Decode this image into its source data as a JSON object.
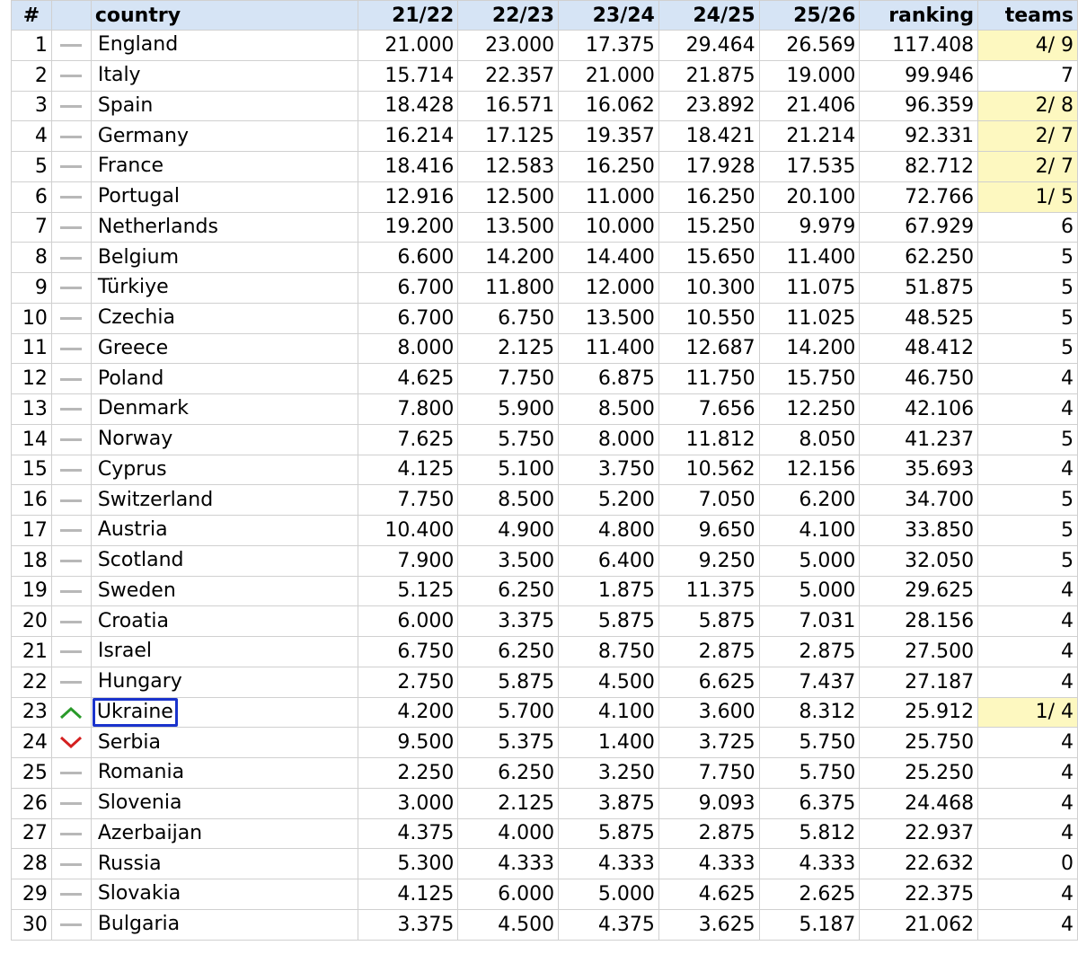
{
  "table": {
    "headers": {
      "rank_no": "#",
      "country": "country",
      "s1": "21/22",
      "s2": "22/23",
      "s3": "23/24",
      "s4": "24/25",
      "s5": "25/26",
      "ranking": "ranking",
      "teams": "teams"
    },
    "selected_country": "Ukraine",
    "colors": {
      "header_bg": "#d6e4f5",
      "teams_highlight": "#fdf8c0",
      "selection_border": "#1a33cc",
      "trend_up": "#2a9a2a",
      "trend_down": "#d42020",
      "trend_same": "#b8b8b8"
    },
    "rows": [
      {
        "no": "1",
        "trend": "same",
        "country": "England",
        "s1": "21.000",
        "s2": "23.000",
        "s3": "17.375",
        "s4": "29.464",
        "s5": "26.569",
        "ranking": "117.408",
        "teams": "4/ 9",
        "teams_highlight": true
      },
      {
        "no": "2",
        "trend": "same",
        "country": "Italy",
        "s1": "15.714",
        "s2": "22.357",
        "s3": "21.000",
        "s4": "21.875",
        "s5": "19.000",
        "ranking": "99.946",
        "teams": "7",
        "teams_highlight": false
      },
      {
        "no": "3",
        "trend": "same",
        "country": "Spain",
        "s1": "18.428",
        "s2": "16.571",
        "s3": "16.062",
        "s4": "23.892",
        "s5": "21.406",
        "ranking": "96.359",
        "teams": "2/ 8",
        "teams_highlight": true
      },
      {
        "no": "4",
        "trend": "same",
        "country": "Germany",
        "s1": "16.214",
        "s2": "17.125",
        "s3": "19.357",
        "s4": "18.421",
        "s5": "21.214",
        "ranking": "92.331",
        "teams": "2/ 7",
        "teams_highlight": true
      },
      {
        "no": "5",
        "trend": "same",
        "country": "France",
        "s1": "18.416",
        "s2": "12.583",
        "s3": "16.250",
        "s4": "17.928",
        "s5": "17.535",
        "ranking": "82.712",
        "teams": "2/ 7",
        "teams_highlight": true
      },
      {
        "no": "6",
        "trend": "same",
        "country": "Portugal",
        "s1": "12.916",
        "s2": "12.500",
        "s3": "11.000",
        "s4": "16.250",
        "s5": "20.100",
        "ranking": "72.766",
        "teams": "1/ 5",
        "teams_highlight": true
      },
      {
        "no": "7",
        "trend": "same",
        "country": "Netherlands",
        "s1": "19.200",
        "s2": "13.500",
        "s3": "10.000",
        "s4": "15.250",
        "s5": "9.979",
        "ranking": "67.929",
        "teams": "6",
        "teams_highlight": false
      },
      {
        "no": "8",
        "trend": "same",
        "country": "Belgium",
        "s1": "6.600",
        "s2": "14.200",
        "s3": "14.400",
        "s4": "15.650",
        "s5": "11.400",
        "ranking": "62.250",
        "teams": "5",
        "teams_highlight": false
      },
      {
        "no": "9",
        "trend": "same",
        "country": "Türkiye",
        "s1": "6.700",
        "s2": "11.800",
        "s3": "12.000",
        "s4": "10.300",
        "s5": "11.075",
        "ranking": "51.875",
        "teams": "5",
        "teams_highlight": false
      },
      {
        "no": "10",
        "trend": "same",
        "country": "Czechia",
        "s1": "6.700",
        "s2": "6.750",
        "s3": "13.500",
        "s4": "10.550",
        "s5": "11.025",
        "ranking": "48.525",
        "teams": "5",
        "teams_highlight": false
      },
      {
        "no": "11",
        "trend": "same",
        "country": "Greece",
        "s1": "8.000",
        "s2": "2.125",
        "s3": "11.400",
        "s4": "12.687",
        "s5": "14.200",
        "ranking": "48.412",
        "teams": "5",
        "teams_highlight": false
      },
      {
        "no": "12",
        "trend": "same",
        "country": "Poland",
        "s1": "4.625",
        "s2": "7.750",
        "s3": "6.875",
        "s4": "11.750",
        "s5": "15.750",
        "ranking": "46.750",
        "teams": "4",
        "teams_highlight": false
      },
      {
        "no": "13",
        "trend": "same",
        "country": "Denmark",
        "s1": "7.800",
        "s2": "5.900",
        "s3": "8.500",
        "s4": "7.656",
        "s5": "12.250",
        "ranking": "42.106",
        "teams": "4",
        "teams_highlight": false
      },
      {
        "no": "14",
        "trend": "same",
        "country": "Norway",
        "s1": "7.625",
        "s2": "5.750",
        "s3": "8.000",
        "s4": "11.812",
        "s5": "8.050",
        "ranking": "41.237",
        "teams": "5",
        "teams_highlight": false
      },
      {
        "no": "15",
        "trend": "same",
        "country": "Cyprus",
        "s1": "4.125",
        "s2": "5.100",
        "s3": "3.750",
        "s4": "10.562",
        "s5": "12.156",
        "ranking": "35.693",
        "teams": "4",
        "teams_highlight": false
      },
      {
        "no": "16",
        "trend": "same",
        "country": "Switzerland",
        "s1": "7.750",
        "s2": "8.500",
        "s3": "5.200",
        "s4": "7.050",
        "s5": "6.200",
        "ranking": "34.700",
        "teams": "5",
        "teams_highlight": false
      },
      {
        "no": "17",
        "trend": "same",
        "country": "Austria",
        "s1": "10.400",
        "s2": "4.900",
        "s3": "4.800",
        "s4": "9.650",
        "s5": "4.100",
        "ranking": "33.850",
        "teams": "5",
        "teams_highlight": false
      },
      {
        "no": "18",
        "trend": "same",
        "country": "Scotland",
        "s1": "7.900",
        "s2": "3.500",
        "s3": "6.400",
        "s4": "9.250",
        "s5": "5.000",
        "ranking": "32.050",
        "teams": "5",
        "teams_highlight": false
      },
      {
        "no": "19",
        "trend": "same",
        "country": "Sweden",
        "s1": "5.125",
        "s2": "6.250",
        "s3": "1.875",
        "s4": "11.375",
        "s5": "5.000",
        "ranking": "29.625",
        "teams": "4",
        "teams_highlight": false
      },
      {
        "no": "20",
        "trend": "same",
        "country": "Croatia",
        "s1": "6.000",
        "s2": "3.375",
        "s3": "5.875",
        "s4": "5.875",
        "s5": "7.031",
        "ranking": "28.156",
        "teams": "4",
        "teams_highlight": false
      },
      {
        "no": "21",
        "trend": "same",
        "country": "Israel",
        "s1": "6.750",
        "s2": "6.250",
        "s3": "8.750",
        "s4": "2.875",
        "s5": "2.875",
        "ranking": "27.500",
        "teams": "4",
        "teams_highlight": false
      },
      {
        "no": "22",
        "trend": "same",
        "country": "Hungary",
        "s1": "2.750",
        "s2": "5.875",
        "s3": "4.500",
        "s4": "6.625",
        "s5": "7.437",
        "ranking": "27.187",
        "teams": "4",
        "teams_highlight": false
      },
      {
        "no": "23",
        "trend": "up",
        "country": "Ukraine",
        "s1": "4.200",
        "s2": "5.700",
        "s3": "4.100",
        "s4": "3.600",
        "s5": "8.312",
        "ranking": "25.912",
        "teams": "1/ 4",
        "teams_highlight": true
      },
      {
        "no": "24",
        "trend": "down",
        "country": "Serbia",
        "s1": "9.500",
        "s2": "5.375",
        "s3": "1.400",
        "s4": "3.725",
        "s5": "5.750",
        "ranking": "25.750",
        "teams": "4",
        "teams_highlight": false
      },
      {
        "no": "25",
        "trend": "same",
        "country": "Romania",
        "s1": "2.250",
        "s2": "6.250",
        "s3": "3.250",
        "s4": "7.750",
        "s5": "5.750",
        "ranking": "25.250",
        "teams": "4",
        "teams_highlight": false
      },
      {
        "no": "26",
        "trend": "same",
        "country": "Slovenia",
        "s1": "3.000",
        "s2": "2.125",
        "s3": "3.875",
        "s4": "9.093",
        "s5": "6.375",
        "ranking": "24.468",
        "teams": "4",
        "teams_highlight": false
      },
      {
        "no": "27",
        "trend": "same",
        "country": "Azerbaijan",
        "s1": "4.375",
        "s2": "4.000",
        "s3": "5.875",
        "s4": "2.875",
        "s5": "5.812",
        "ranking": "22.937",
        "teams": "4",
        "teams_highlight": false
      },
      {
        "no": "28",
        "trend": "same",
        "country": "Russia",
        "s1": "5.300",
        "s2": "4.333",
        "s3": "4.333",
        "s4": "4.333",
        "s5": "4.333",
        "ranking": "22.632",
        "teams": "0",
        "teams_highlight": false
      },
      {
        "no": "29",
        "trend": "same",
        "country": "Slovakia",
        "s1": "4.125",
        "s2": "6.000",
        "s3": "5.000",
        "s4": "4.625",
        "s5": "2.625",
        "ranking": "22.375",
        "teams": "4",
        "teams_highlight": false
      },
      {
        "no": "30",
        "trend": "same",
        "country": "Bulgaria",
        "s1": "3.375",
        "s2": "4.500",
        "s3": "4.375",
        "s4": "3.625",
        "s5": "5.187",
        "ranking": "21.062",
        "teams": "4",
        "teams_highlight": false
      }
    ]
  }
}
